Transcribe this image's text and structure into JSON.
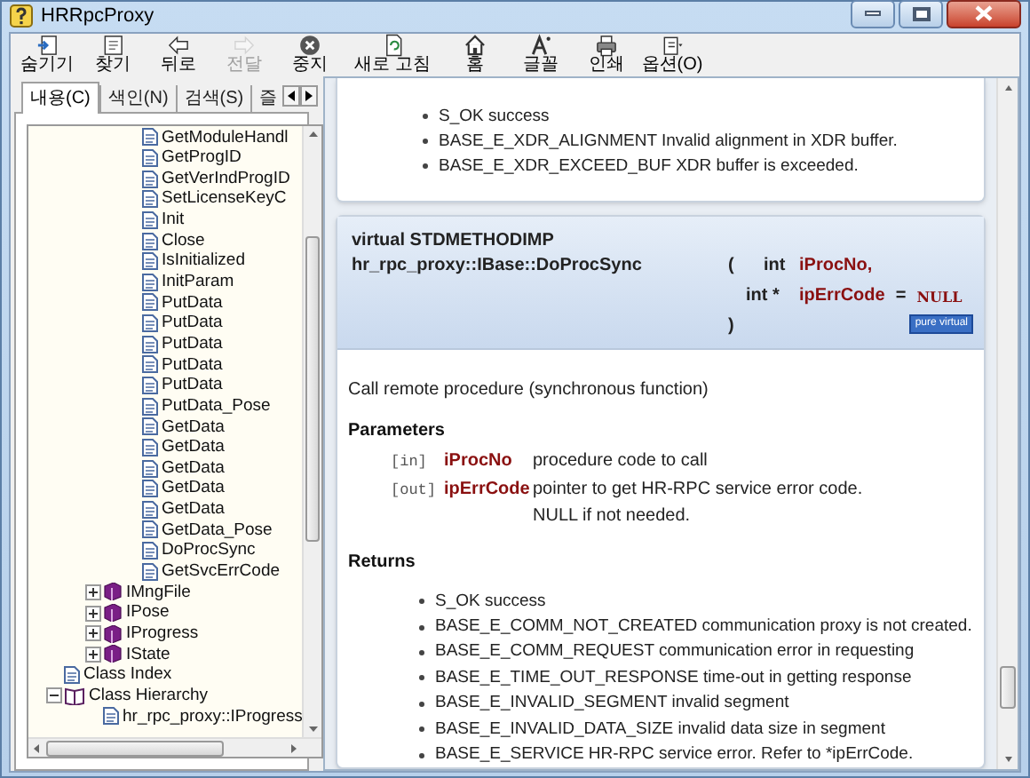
{
  "window": {
    "title": "HRRpcProxy"
  },
  "toolbar": [
    {
      "label": "숨기기",
      "disabled": false
    },
    {
      "label": "찾기",
      "disabled": false
    },
    {
      "label": "뒤로",
      "disabled": false
    },
    {
      "label": "전달",
      "disabled": true
    },
    {
      "label": "중지",
      "disabled": false
    },
    {
      "label": "새로 고침",
      "disabled": false
    },
    {
      "label": "홈",
      "disabled": false
    },
    {
      "label": "글꼴",
      "disabled": false
    },
    {
      "label": "인쇄",
      "disabled": false
    },
    {
      "label": "옵션(O)",
      "disabled": false
    }
  ],
  "sidebar": {
    "tabs": [
      {
        "label": "내용(C)",
        "selected": true
      },
      {
        "label": "색인(N)",
        "selected": false
      },
      {
        "label": "검색(S)",
        "selected": false
      },
      {
        "label": "즐",
        "selected": false
      }
    ],
    "tree": [
      {
        "children": [
          {
            "children": [
              {
                "label": "GetModuleHandl",
                "kind": "page"
              },
              {
                "label": "GetProgID",
                "kind": "page"
              },
              {
                "label": "GetVerIndProgID",
                "kind": "page"
              },
              {
                "label": "SetLicenseKeyC",
                "kind": "page"
              },
              {
                "label": "Init",
                "kind": "page"
              },
              {
                "label": "Close",
                "kind": "page"
              },
              {
                "label": "IsInitialized",
                "kind": "page"
              },
              {
                "label": "InitParam",
                "kind": "page"
              },
              {
                "label": "PutData",
                "kind": "page"
              },
              {
                "label": "PutData",
                "kind": "page"
              },
              {
                "label": "PutData",
                "kind": "page"
              },
              {
                "label": "PutData",
                "kind": "page"
              },
              {
                "label": "PutData",
                "kind": "page"
              },
              {
                "label": "PutData_Pose",
                "kind": "page"
              },
              {
                "label": "GetData",
                "kind": "page"
              },
              {
                "label": "GetData",
                "kind": "page"
              },
              {
                "label": "GetData",
                "kind": "page"
              },
              {
                "label": "GetData",
                "kind": "page"
              },
              {
                "label": "GetData",
                "kind": "page"
              },
              {
                "label": "GetData_Pose",
                "kind": "page"
              },
              {
                "label": "DoProcSync",
                "kind": "page"
              },
              {
                "label": "GetSvcErrCode",
                "kind": "page"
              }
            ]
          },
          {
            "label": "IMngFile",
            "kind": "book",
            "expanded": false
          },
          {
            "label": "IPose",
            "kind": "book",
            "expanded": false
          },
          {
            "label": "IProgress",
            "kind": "book",
            "expanded": false
          },
          {
            "label": "IState",
            "kind": "book",
            "expanded": false
          }
        ]
      },
      {
        "label": "Class Index",
        "kind": "page"
      },
      {
        "label": "Class Hierarchy",
        "kind": "open-book",
        "expanded": true,
        "children": [
          {
            "label": "hr_rpc_proxy::IProgress",
            "kind": "page"
          }
        ]
      }
    ]
  },
  "content": {
    "previous_returns": [
      "S_OK success",
      "BASE_E_XDR_ALIGNMENT Invalid alignment in XDR buffer.",
      "BASE_E_XDR_EXCEED_BUF XDR buffer is exceeded."
    ],
    "member": {
      "qualifier": "virtual STDMETHODIMP",
      "name": "hr_rpc_proxy::IBase::DoProcSync",
      "open_paren": "(",
      "params": [
        {
          "type": "int",
          "name": "iProcNo,"
        },
        {
          "type": "int *",
          "name": "ipErrCode",
          "default_sign": "=",
          "default": "NULL"
        }
      ],
      "close_paren": ")",
      "badge": "pure virtual",
      "description": "Call remote procedure (synchronous function)",
      "parameters_heading": "Parameters",
      "parameters": [
        {
          "direction": "[in]",
          "name": "iProcNo",
          "lines": [
            "procedure code to call"
          ]
        },
        {
          "direction": "[out]",
          "name": "ipErrCode",
          "lines": [
            "pointer to get HR-RPC service error code.",
            "NULL if not needed."
          ]
        }
      ],
      "returns_heading": "Returns",
      "returns": [
        "S_OK success",
        "BASE_E_COMM_NOT_CREATED communication proxy is not created.",
        "BASE_E_COMM_REQUEST communication error in requesting",
        "BASE_E_TIME_OUT_RESPONSE time-out in getting response",
        "BASE_E_INVALID_SEGMENT invalid segment",
        "BASE_E_INVALID_DATA_SIZE invalid data size in segment",
        "BASE_E_SERVICE HR-RPC service error. Refer to *ipErrCode."
      ]
    }
  }
}
